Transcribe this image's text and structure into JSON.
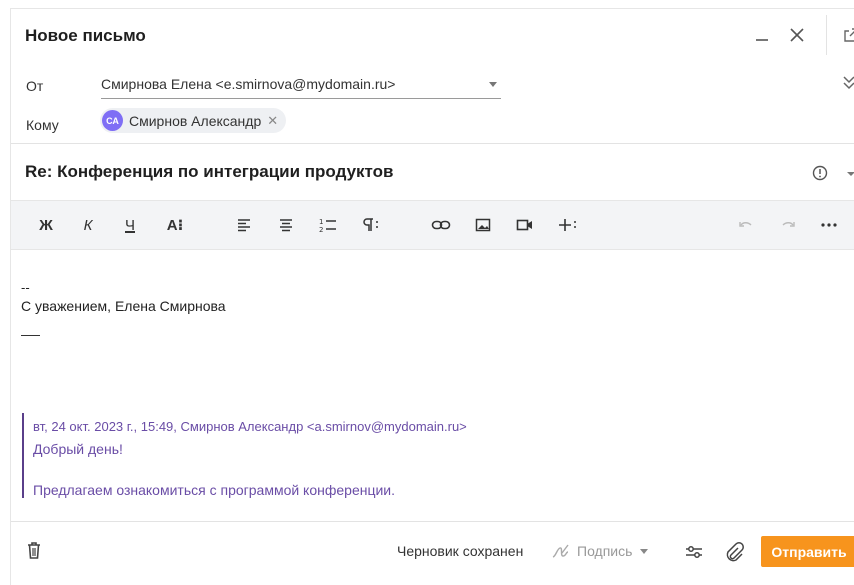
{
  "header": {
    "title": "Новое письмо"
  },
  "from": {
    "label": "От",
    "value": "Смирнова Елена <e.smirnova@mydomain.ru>"
  },
  "to": {
    "label": "Кому",
    "recipients": [
      {
        "initials": "СА",
        "name": "Смирнов Александр"
      }
    ]
  },
  "subject": "Re: Конференция по интеграции продуктов",
  "toolbar": {
    "bold_label": "Ж",
    "italic_label": "К",
    "underline_label": "Ч",
    "font_label": "A⁝"
  },
  "body": {
    "signature_dash": "--",
    "signature_line": "С уважением, Елена Смирнова",
    "quote": {
      "meta": "вт, 24 окт. 2023 г., 15:49, Смирнов Александр <a.smirnov@mydomain.ru>",
      "line1": "Добрый день!",
      "line2": "Предлагаем ознакомиться с программой конференции."
    }
  },
  "footer": {
    "draft_status": "Черновик сохранен",
    "signature_label": "Подпись",
    "send_label": "Отправить"
  },
  "colors": {
    "accent": "#f7941d",
    "avatar": "#7f6ef5",
    "quote": "#6a4da6"
  }
}
